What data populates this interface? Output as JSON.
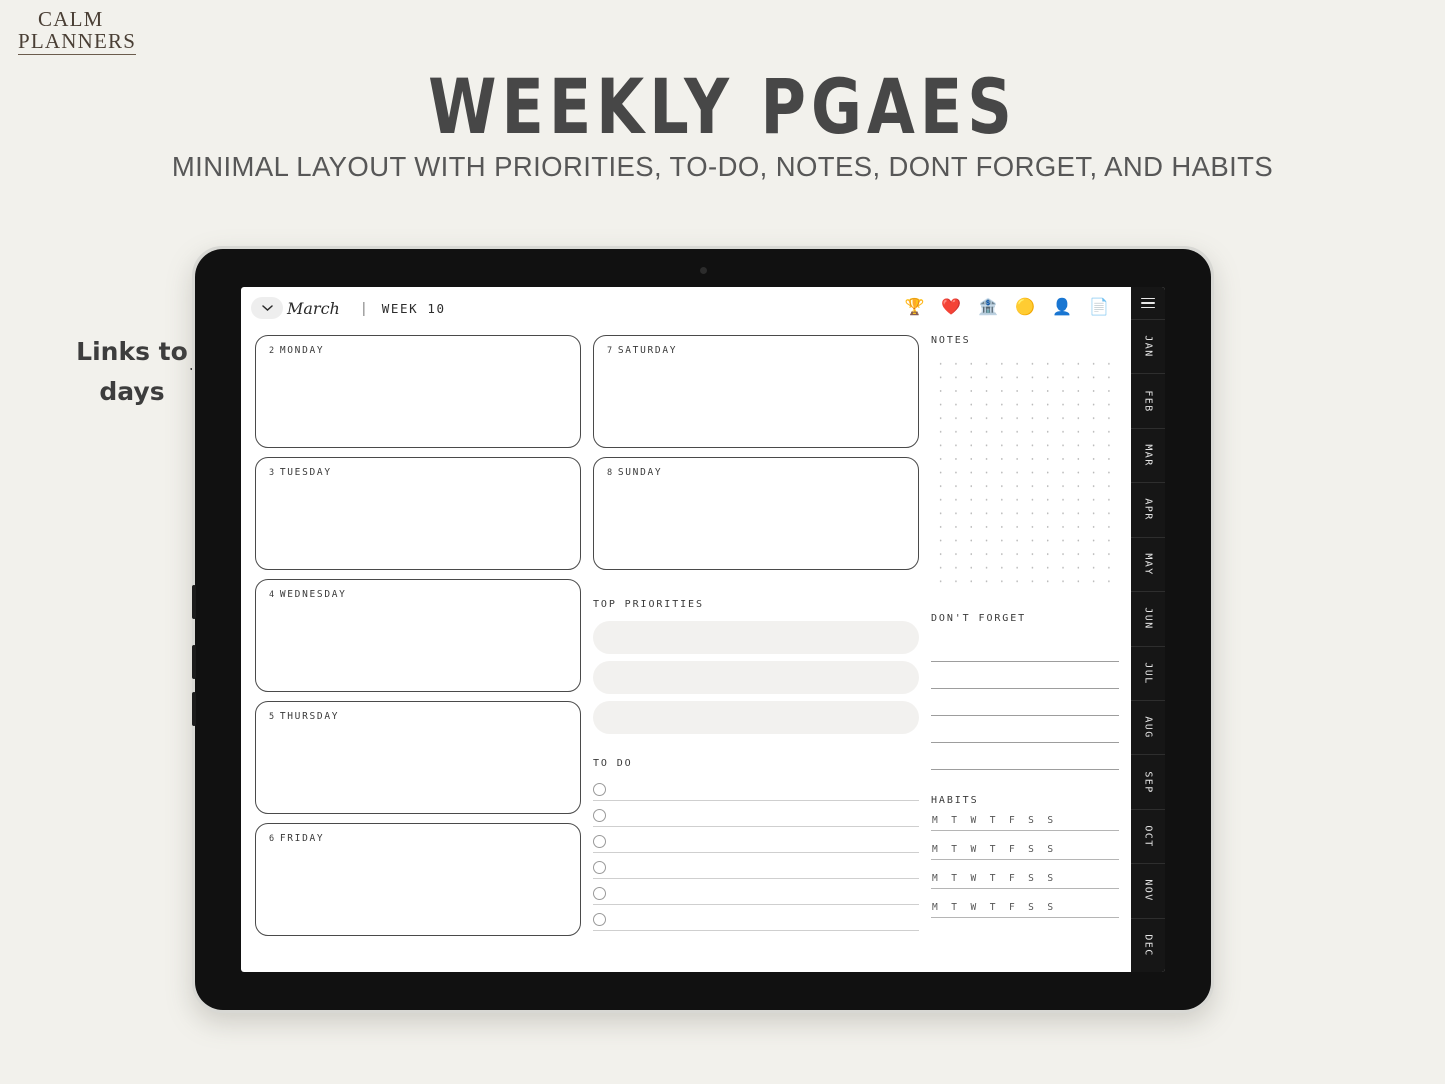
{
  "brand": {
    "line1": "CALM",
    "line2": "PLANNERS"
  },
  "headline": "WEEKLY PGAES",
  "subheadline": "MINIMAL LAYOUT WITH PRIORITIES, TO-DO, NOTES, DONT FORGET,  AND HABITS",
  "annotation": {
    "line1": "Links to",
    "line2": "days"
  },
  "app": {
    "month": "March",
    "divider": "|",
    "week": "WEEK 10",
    "icons": [
      {
        "name": "trophy-icon",
        "glyph": "🏆"
      },
      {
        "name": "heart-icon",
        "glyph": "❤️"
      },
      {
        "name": "bank-icon",
        "glyph": "🏦"
      },
      {
        "name": "coin-icon",
        "glyph": "🟡"
      },
      {
        "name": "person-icon",
        "glyph": "👤"
      },
      {
        "name": "document-icon",
        "glyph": "📄"
      }
    ]
  },
  "weekdays": [
    {
      "num": "2",
      "name": "MONDAY"
    },
    {
      "num": "3",
      "name": "TUESDAY"
    },
    {
      "num": "4",
      "name": "WEDNESDAY"
    },
    {
      "num": "5",
      "name": "THURSDAY"
    },
    {
      "num": "6",
      "name": "FRIDAY"
    }
  ],
  "weekend": [
    {
      "num": "7",
      "name": "SATURDAY"
    },
    {
      "num": "8",
      "name": "SUNDAY"
    }
  ],
  "sections": {
    "priorities_title": "TOP PRIORITIES",
    "priorities_count": 3,
    "todo_title": "TO DO",
    "todo_count": 6,
    "notes_title": "NOTES",
    "dont_forget_title": "DON'T FORGET",
    "dont_forget_count": 5,
    "habits_title": "HABITS",
    "habits_rows": 4,
    "habit_days": [
      "M",
      "T",
      "W",
      "T",
      "F",
      "S",
      "S"
    ]
  },
  "rail": {
    "menu_icon": "hamburger-menu-icon",
    "months": [
      "JAN",
      "FEB",
      "MAR",
      "APR",
      "MAY",
      "JUN",
      "JUL",
      "AUG",
      "SEP",
      "OCT",
      "NOV",
      "DEC"
    ]
  },
  "colors": {
    "page_bg": "#f2f1ec",
    "headline": "#474747",
    "rail_bg": "#161616",
    "bezel": "#111111",
    "priority_bar": "#f2f1ef"
  }
}
